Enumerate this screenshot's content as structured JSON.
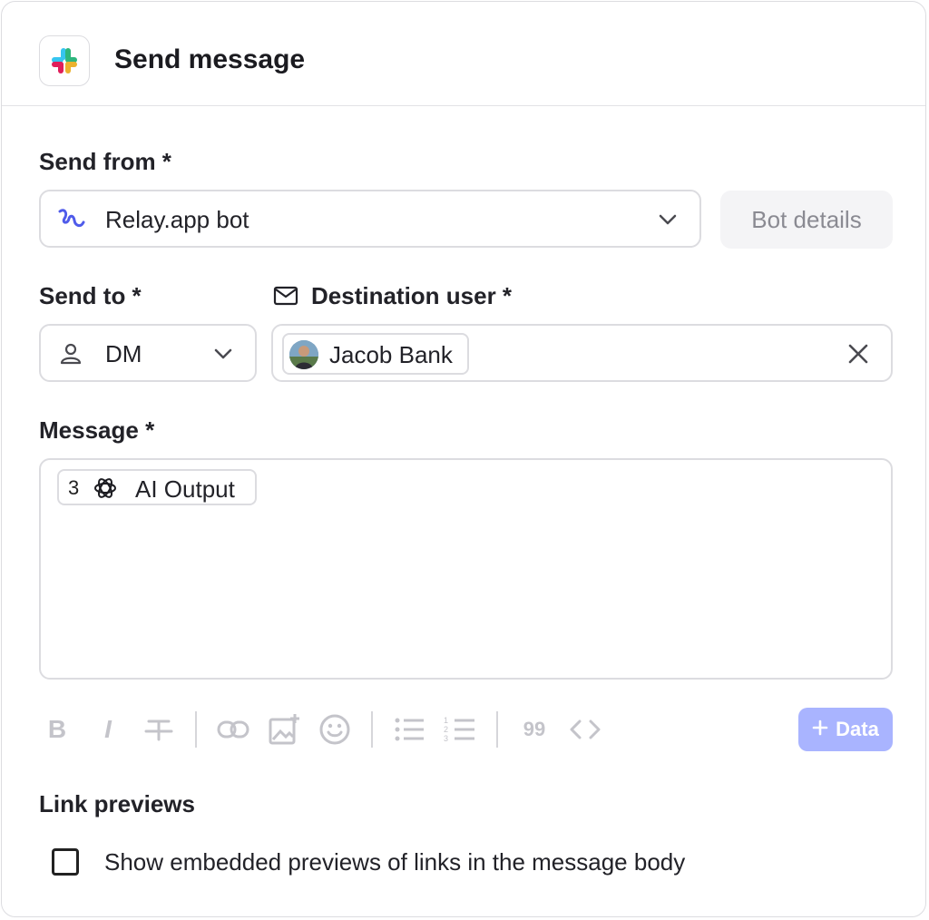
{
  "header": {
    "title": "Send message",
    "app_icon": "slack-icon"
  },
  "send_from": {
    "label": "Send from *",
    "value": "Relay.app bot",
    "icon": "relay-icon",
    "details_button": "Bot details"
  },
  "send_to": {
    "label": "Send to *",
    "value": "DM",
    "icon": "person-icon"
  },
  "destination": {
    "label": "Destination user *",
    "icon": "mail-icon",
    "user_name": "Jacob Bank"
  },
  "message": {
    "label": "Message *",
    "chip_number": "3",
    "chip_label": "AI Output",
    "chip_icon": "openai-icon"
  },
  "toolbar": {
    "items": [
      "bold-icon",
      "italic-icon",
      "strikethrough-icon",
      "link-icon",
      "add-image-icon",
      "emoji-icon",
      "bullet-list-icon",
      "numbered-list-icon",
      "quote-icon",
      "code-icon"
    ],
    "quote_text": "99",
    "data_button": "Data"
  },
  "link_previews": {
    "label": "Link previews",
    "checkbox_label": "Show embedded previews of links in the message body",
    "checked": false
  },
  "colors": {
    "accent_button": "#a9b4ff",
    "relay_icon": "#4f5bea",
    "border": "#dcdce0"
  }
}
